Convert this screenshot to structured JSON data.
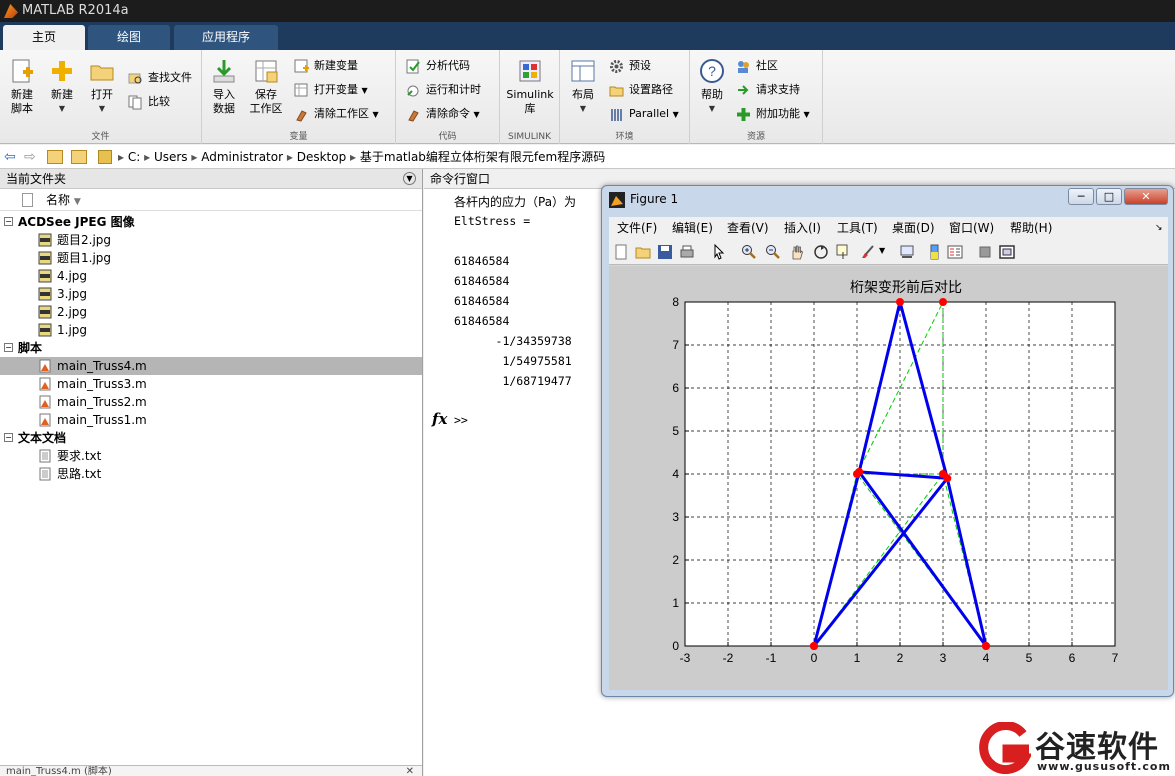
{
  "window": {
    "title": "MATLAB R2014a"
  },
  "tabs": [
    {
      "label": "主页"
    },
    {
      "label": "绘图"
    },
    {
      "label": "应用程序"
    }
  ],
  "ribbon": {
    "groups": [
      "文件",
      "变量",
      "代码",
      "SIMULINK",
      "环境",
      "资源"
    ],
    "new_script": "新建\n脚本",
    "new": "新建",
    "open": "打开",
    "find_files": "查找文件",
    "compare": "比较",
    "import_data": "导入\n数据",
    "save_workspace": "保存\n工作区",
    "new_variable": "新建变量",
    "open_variable": "打开变量",
    "clear_workspace": "清除工作区",
    "analyze_code": "分析代码",
    "run_and_time": "运行和计时",
    "clear_commands": "清除命令",
    "simulink": "Simulink\n库",
    "layout": "布局",
    "preferences": "预设",
    "set_path": "设置路径",
    "parallel": "Parallel",
    "help": "帮助",
    "community": "社区",
    "request_support": "请求支持",
    "add_ons": "附加功能"
  },
  "address": {
    "path": [
      "C:",
      "Users",
      "Administrator",
      "Desktop",
      "基于matlab编程立体桁架有限元fem程序源码"
    ]
  },
  "current_folder": {
    "title": "当前文件夹",
    "column_name": "名称",
    "groups": [
      {
        "label": "ACDSee JPEG 图像",
        "items": [
          "题目2.jpg",
          "题目1.jpg",
          "4.jpg",
          "3.jpg",
          "2.jpg",
          "1.jpg"
        ]
      },
      {
        "label": "脚本",
        "items": [
          "main_Truss4.m",
          "main_Truss3.m",
          "main_Truss2.m",
          "main_Truss1.m"
        ]
      },
      {
        "label": "文本文档",
        "items": [
          "要求.txt",
          "思路.txt"
        ]
      }
    ],
    "footer": "main_Truss4.m (脚本)"
  },
  "command_window": {
    "title": "命令行窗口",
    "lines": [
      "各杆内的应力（Pa）为",
      "EltStress =",
      "",
      "61846584",
      "61846584",
      "61846584",
      "61846584",
      "      -1/34359738",
      "       1/54975581",
      "       1/68719477"
    ],
    "prompt": ">>",
    "fx": "fx"
  },
  "figure": {
    "title": "Figure 1",
    "menu": [
      "文件(F)",
      "编辑(E)",
      "查看(V)",
      "插入(I)",
      "工具(T)",
      "桌面(D)",
      "窗口(W)",
      "帮助(H)"
    ]
  },
  "chart_data": {
    "type": "line",
    "title": "桁架变形前后对比",
    "xlabel": "",
    "ylabel": "",
    "xlim": [
      -3,
      7
    ],
    "ylim": [
      0,
      8
    ],
    "xticks": [
      -3,
      -2,
      -1,
      0,
      1,
      2,
      3,
      4,
      5,
      6,
      7
    ],
    "yticks": [
      0,
      1,
      2,
      3,
      4,
      5,
      6,
      7,
      8
    ],
    "grid": true,
    "original": {
      "color": "#00cc00",
      "style": "dashed",
      "nodes": [
        [
          0,
          0
        ],
        [
          4,
          0
        ],
        [
          1,
          4
        ],
        [
          3,
          4
        ],
        [
          3,
          8
        ]
      ],
      "members": [
        [
          0,
          2
        ],
        [
          1,
          3
        ],
        [
          2,
          3
        ],
        [
          0,
          3
        ],
        [
          1,
          2
        ],
        [
          2,
          4
        ],
        [
          3,
          4
        ]
      ]
    },
    "deformed": {
      "color": "#0000ee",
      "style": "solid",
      "nodes": [
        [
          0,
          0
        ],
        [
          4,
          0
        ],
        [
          1.05,
          4.05
        ],
        [
          3.1,
          3.9
        ],
        [
          2,
          8
        ]
      ],
      "members": [
        [
          0,
          2
        ],
        [
          1,
          3
        ],
        [
          2,
          3
        ],
        [
          0,
          3
        ],
        [
          1,
          2
        ],
        [
          2,
          4
        ],
        [
          3,
          4
        ]
      ]
    },
    "node_color": "#ff0000"
  },
  "watermark": {
    "brand": "谷速软件",
    "url": "www.gususoft.com"
  }
}
